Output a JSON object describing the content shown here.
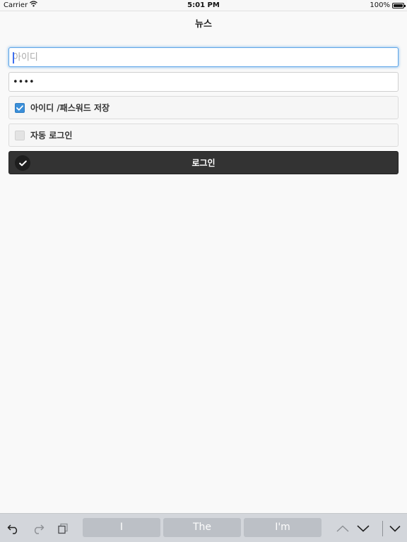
{
  "status_bar": {
    "carrier": "Carrier",
    "time": "5:01 PM",
    "battery_text": "100%",
    "battery_level": 1.0
  },
  "header": {
    "title": "뉴스"
  },
  "form": {
    "username": {
      "value": "",
      "placeholder": "아이디"
    },
    "password": {
      "value": "1234",
      "placeholder": ""
    },
    "save_credentials": {
      "label": "아이디 /패스워드 저장",
      "checked": true
    },
    "auto_login": {
      "label": "자동 로그인",
      "checked": false
    },
    "login_button": {
      "label": "로그인"
    }
  },
  "keyboard_bar": {
    "suggestions": [
      "I",
      "The",
      "I'm"
    ],
    "icons": [
      "undo-icon",
      "redo-icon",
      "paste-icon",
      "chevron-up-icon",
      "chevron-down-icon",
      "keyboard-dismiss-icon"
    ]
  },
  "colors": {
    "accent": "#3b8fd9",
    "focus_ring": "#5fa6e8",
    "button_dark": "#333333",
    "keyboard_bar": "#d3d6db"
  }
}
